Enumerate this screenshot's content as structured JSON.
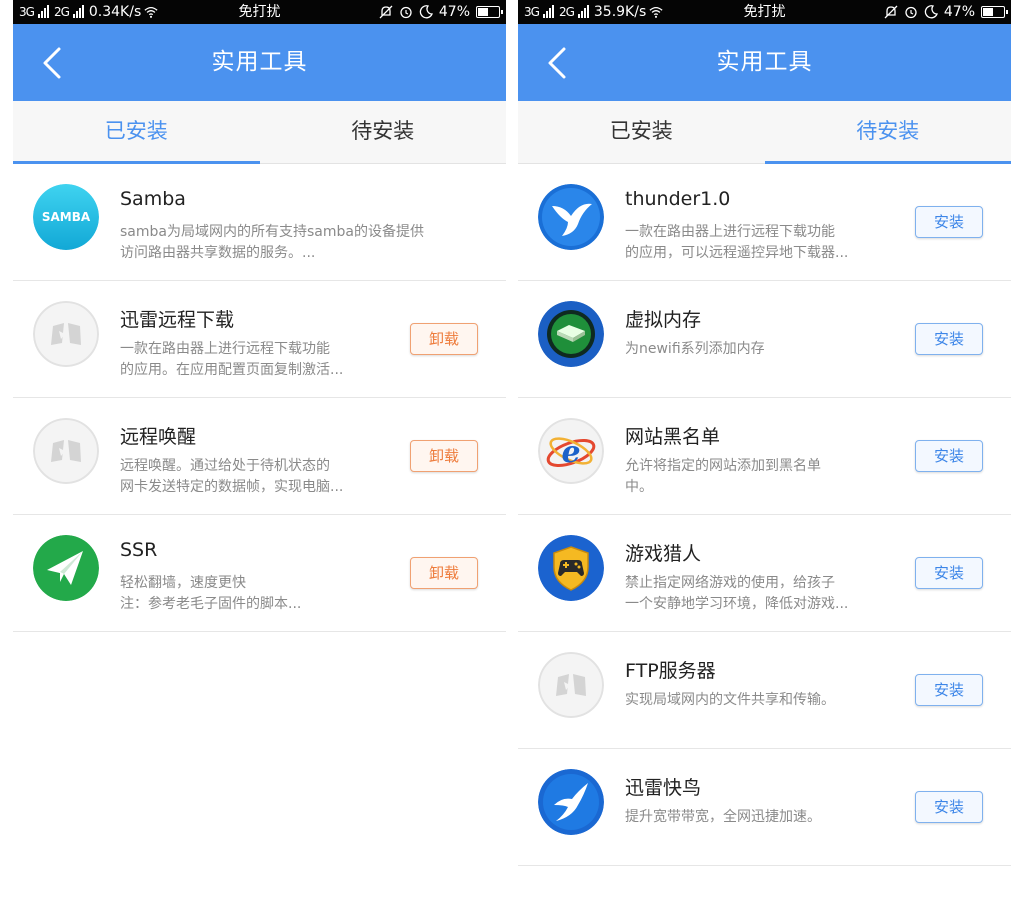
{
  "left": {
    "status": {
      "net": "3G",
      "net2": "2G",
      "speed": "0.34K/s",
      "mode": "免打扰",
      "battery": "47%"
    },
    "nav": {
      "title": "实用工具"
    },
    "tabs": [
      "已安装",
      "待安装"
    ],
    "active_tab": 0,
    "items": [
      {
        "title": "Samba",
        "desc1": "samba为局域网内的所有支持samba的设备提供",
        "desc2": "访问路由器共享数据的服务。...",
        "icon": "samba-icon",
        "logo_text": "SAMBA",
        "button": ""
      },
      {
        "title": "迅雷远程下载",
        "desc1": "一款在路由器上进行远程下载功能",
        "desc2": "的应用。在应用配置页面复制激活...",
        "icon": "placeholder-app-icon",
        "button": "卸载"
      },
      {
        "title": "远程唤醒",
        "desc1": "远程唤醒。通过给处于待机状态的",
        "desc2": "网卡发送特定的数据帧，实现电脑...",
        "icon": "placeholder-app-icon",
        "button": "卸载"
      },
      {
        "title": "SSR",
        "desc1": "轻松翻墙，速度更快",
        "desc2": "注：参考老毛子固件的脚本...",
        "icon": "paper-plane-icon",
        "button": "卸载"
      }
    ]
  },
  "right": {
    "status": {
      "net": "3G",
      "net2": "2G",
      "speed": "35.9K/s",
      "mode": "免打扰",
      "battery": "47%"
    },
    "nav": {
      "title": "实用工具"
    },
    "tabs": [
      "已安装",
      "待安装"
    ],
    "active_tab": 1,
    "items": [
      {
        "title": "thunder1.0",
        "desc1": "一款在路由器上进行远程下载功能",
        "desc2": "的应用，可以远程遥控异地下载器...",
        "icon": "thunder-bird-icon",
        "button": "安装"
      },
      {
        "title": "虚拟内存",
        "desc1": "为newifi系列添加内存",
        "desc2": "",
        "icon": "hard-drive-icon",
        "button": "安装"
      },
      {
        "title": "网站黑名单",
        "desc1": "允许将指定的网站添加到黑名单",
        "desc2": "中。",
        "icon": "ie-browser-icon",
        "button": "安装"
      },
      {
        "title": "游戏猎人",
        "desc1": "禁止指定网络游戏的使用，给孩子",
        "desc2": "一个安静地学习环境，降低对游戏...",
        "icon": "gamepad-shield-icon",
        "button": "安装"
      },
      {
        "title": "FTP服务器",
        "desc1": "实现局域网内的文件共享和传输。",
        "desc2": "",
        "icon": "placeholder-app-icon",
        "button": "安装"
      },
      {
        "title": "迅雷快鸟",
        "desc1": "提升宽带带宽，全网迅捷加速。",
        "desc2": "",
        "icon": "swallow-bird-icon",
        "button": "安装"
      }
    ]
  },
  "colors": {
    "primary": "#4b92ef",
    "uninstall": "#ee7c3c",
    "install": "#3d86e8"
  }
}
